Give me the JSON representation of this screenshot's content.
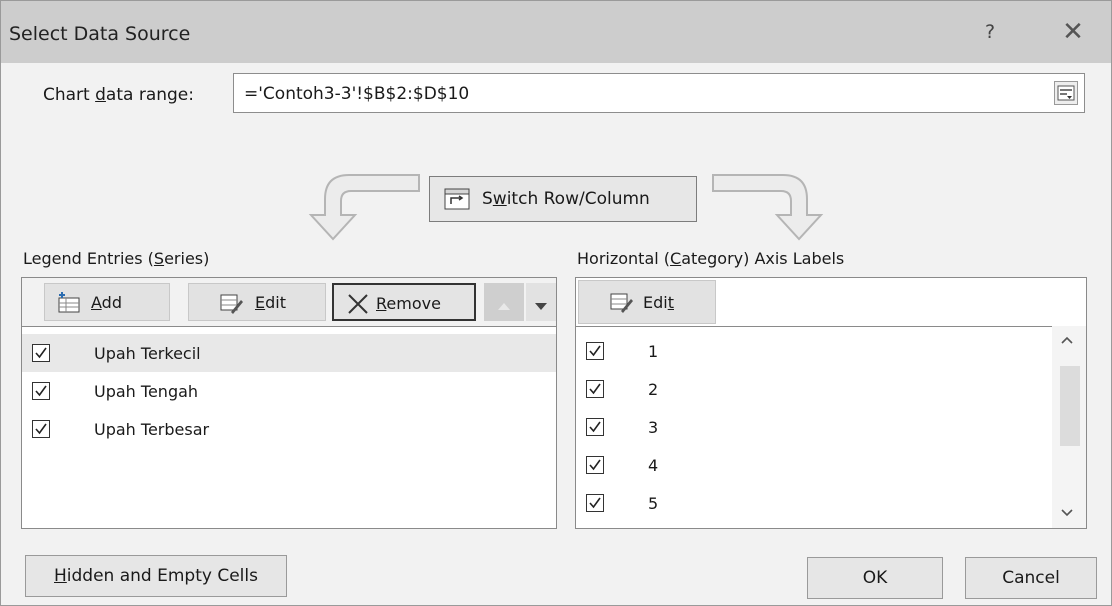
{
  "dialog": {
    "title": "Select Data Source",
    "help_glyph": "?",
    "close_glyph": "✕"
  },
  "range": {
    "label_pre": "Chart ",
    "label_accel": "d",
    "label_post": "ata range:",
    "value": "='Contoh3-3'!$B$2:$D$10"
  },
  "switch": {
    "label_pre": "S",
    "label_accel": "w",
    "label_post": "itch Row/Column"
  },
  "legend": {
    "label_pre": "Legend Entries (",
    "label_accel": "S",
    "label_post": "eries)",
    "add": {
      "pre": "",
      "accel": "A",
      "post": "dd"
    },
    "edit": {
      "pre": "",
      "accel": "E",
      "post": "dit"
    },
    "remove": {
      "pre": "",
      "accel": "R",
      "post": "emove"
    },
    "series": [
      {
        "label": "Upah Terkecil",
        "checked": true
      },
      {
        "label": "Upah Tengah",
        "checked": true
      },
      {
        "label": "Upah Terbesar",
        "checked": true
      }
    ]
  },
  "axis": {
    "label_pre": "Horizontal (",
    "label_accel": "C",
    "label_post": "ategory) Axis Labels",
    "edit": {
      "pre": "Edi",
      "accel": "t",
      "post": ""
    },
    "items": [
      {
        "label": "1",
        "checked": true
      },
      {
        "label": "2",
        "checked": true
      },
      {
        "label": "3",
        "checked": true
      },
      {
        "label": "4",
        "checked": true
      },
      {
        "label": "5",
        "checked": true
      }
    ]
  },
  "footer": {
    "hidden": {
      "pre": "",
      "accel": "H",
      "post": "idden and Empty Cells"
    },
    "ok": "OK",
    "cancel": "Cancel"
  },
  "icons": {
    "add": "add-series-icon",
    "edit": "edit-icon",
    "remove": "remove-icon",
    "up": "move-up-icon",
    "down": "move-down-icon",
    "switch": "switch-icon",
    "collapse": "collapse-dialog-icon"
  }
}
